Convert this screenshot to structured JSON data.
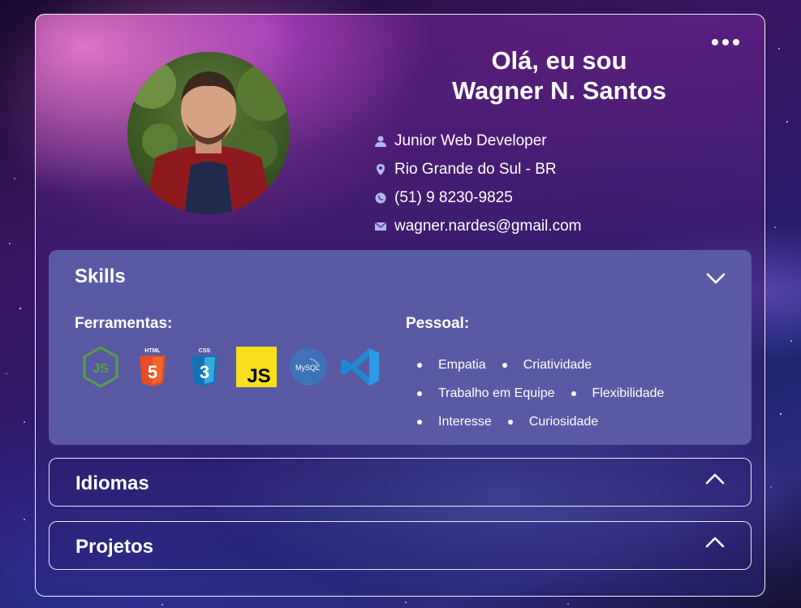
{
  "profile": {
    "greeting": "Olá, eu sou",
    "name": "Wagner N. Santos",
    "avatar_alt": "profile photo",
    "details": [
      {
        "icon": "user-icon",
        "text": "Junior Web Developer"
      },
      {
        "icon": "location-pin-icon",
        "text": "Rio Grande do Sul - BR"
      },
      {
        "icon": "whatsapp-icon",
        "text": "(51) 9 8230-9825"
      },
      {
        "icon": "mail-icon",
        "text": "wagner.nardes@gmail.com"
      }
    ]
  },
  "menu": {
    "icon": "more-options-icon"
  },
  "skills": {
    "title": "Skills",
    "tools_label": "Ferramentas:",
    "tools": [
      {
        "name": "nodejs-icon",
        "label": "JS"
      },
      {
        "name": "html5-icon",
        "label": "HTML",
        "digit": "5"
      },
      {
        "name": "css3-icon",
        "label": "CSS",
        "digit": "3"
      },
      {
        "name": "javascript-icon",
        "label": "JS"
      },
      {
        "name": "mysql-icon",
        "label": "MySQL"
      },
      {
        "name": "vscode-icon",
        "label": ""
      }
    ],
    "soft_label": "Pessoal:",
    "soft": [
      [
        "Empatia",
        "Criatividade"
      ],
      [
        "Trabalho em Equipe",
        "Flexibilidade"
      ],
      [
        "Interesse",
        "Curiosidade"
      ]
    ]
  },
  "languages": {
    "title": "Idiomas"
  },
  "projects": {
    "title": "Projetos"
  },
  "colors": {
    "skills_panel": "#5a5aa4",
    "icon_tint": "#b0b6f0"
  }
}
